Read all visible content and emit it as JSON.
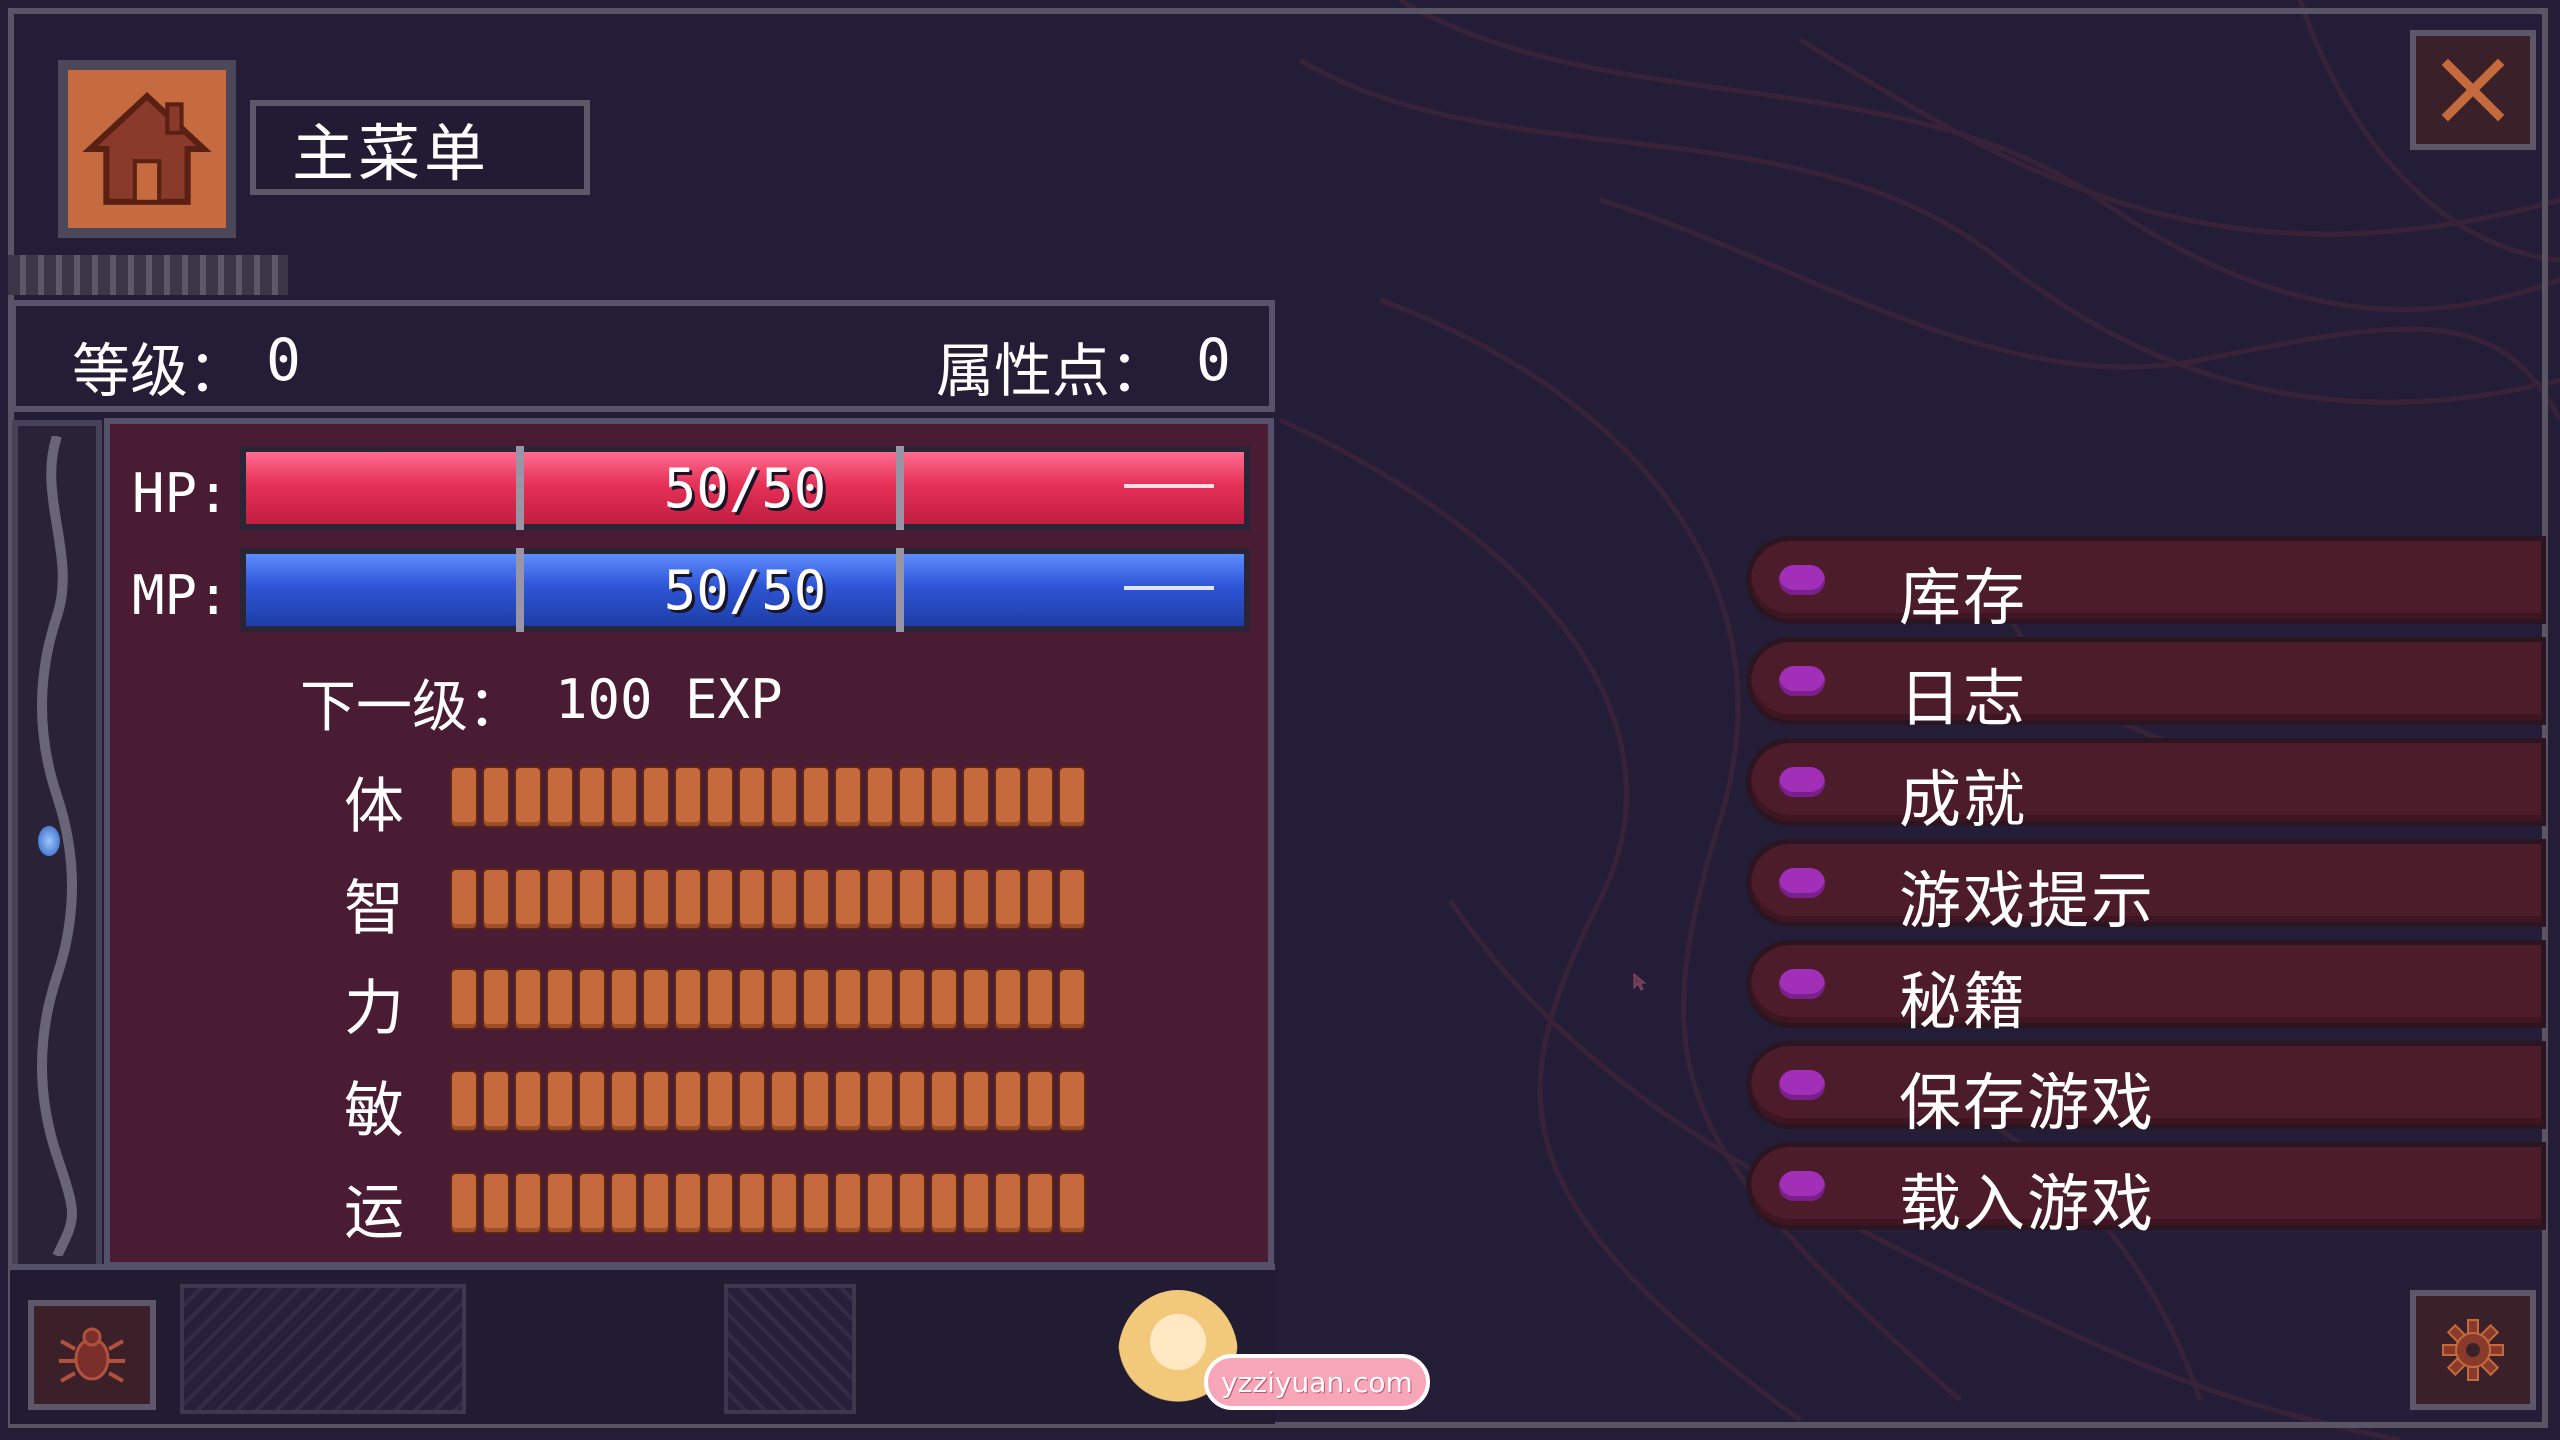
{
  "header": {
    "title": "主菜单"
  },
  "level_strip": {
    "level_label": "等级：",
    "level_value": "0",
    "points_label": "属性点：",
    "points_value": "0"
  },
  "stats": {
    "hp": {
      "label": "HP:",
      "text": "50/50",
      "current": 50,
      "max": 50
    },
    "mp": {
      "label": "MP:",
      "text": "50/50",
      "current": 50,
      "max": 50
    },
    "next_level": {
      "label": "下一级：",
      "value": "100 EXP"
    },
    "attributes": [
      {
        "label": "体",
        "pips": 20
      },
      {
        "label": "智",
        "pips": 20
      },
      {
        "label": "力",
        "pips": 20
      },
      {
        "label": "敏",
        "pips": 20
      },
      {
        "label": "运",
        "pips": 20
      }
    ]
  },
  "menu": {
    "items": [
      {
        "label": "库存"
      },
      {
        "label": "日志"
      },
      {
        "label": "成就"
      },
      {
        "label": "游戏提示"
      },
      {
        "label": "秘籍"
      },
      {
        "label": "保存游戏"
      },
      {
        "label": "载入游戏"
      }
    ]
  },
  "watermark": {
    "text": "yzziyuan.com"
  },
  "icons": {
    "home": "home-icon",
    "close": "close-icon",
    "settings": "gear-icon",
    "debug": "bug-icon"
  },
  "colors": {
    "hp": "#e63158",
    "mp": "#2e55d6",
    "pip": "#c46a3c",
    "menu_bg": "#4c1c2a",
    "menu_bullet": "#a12fb8",
    "panel": "#4a1c33"
  }
}
